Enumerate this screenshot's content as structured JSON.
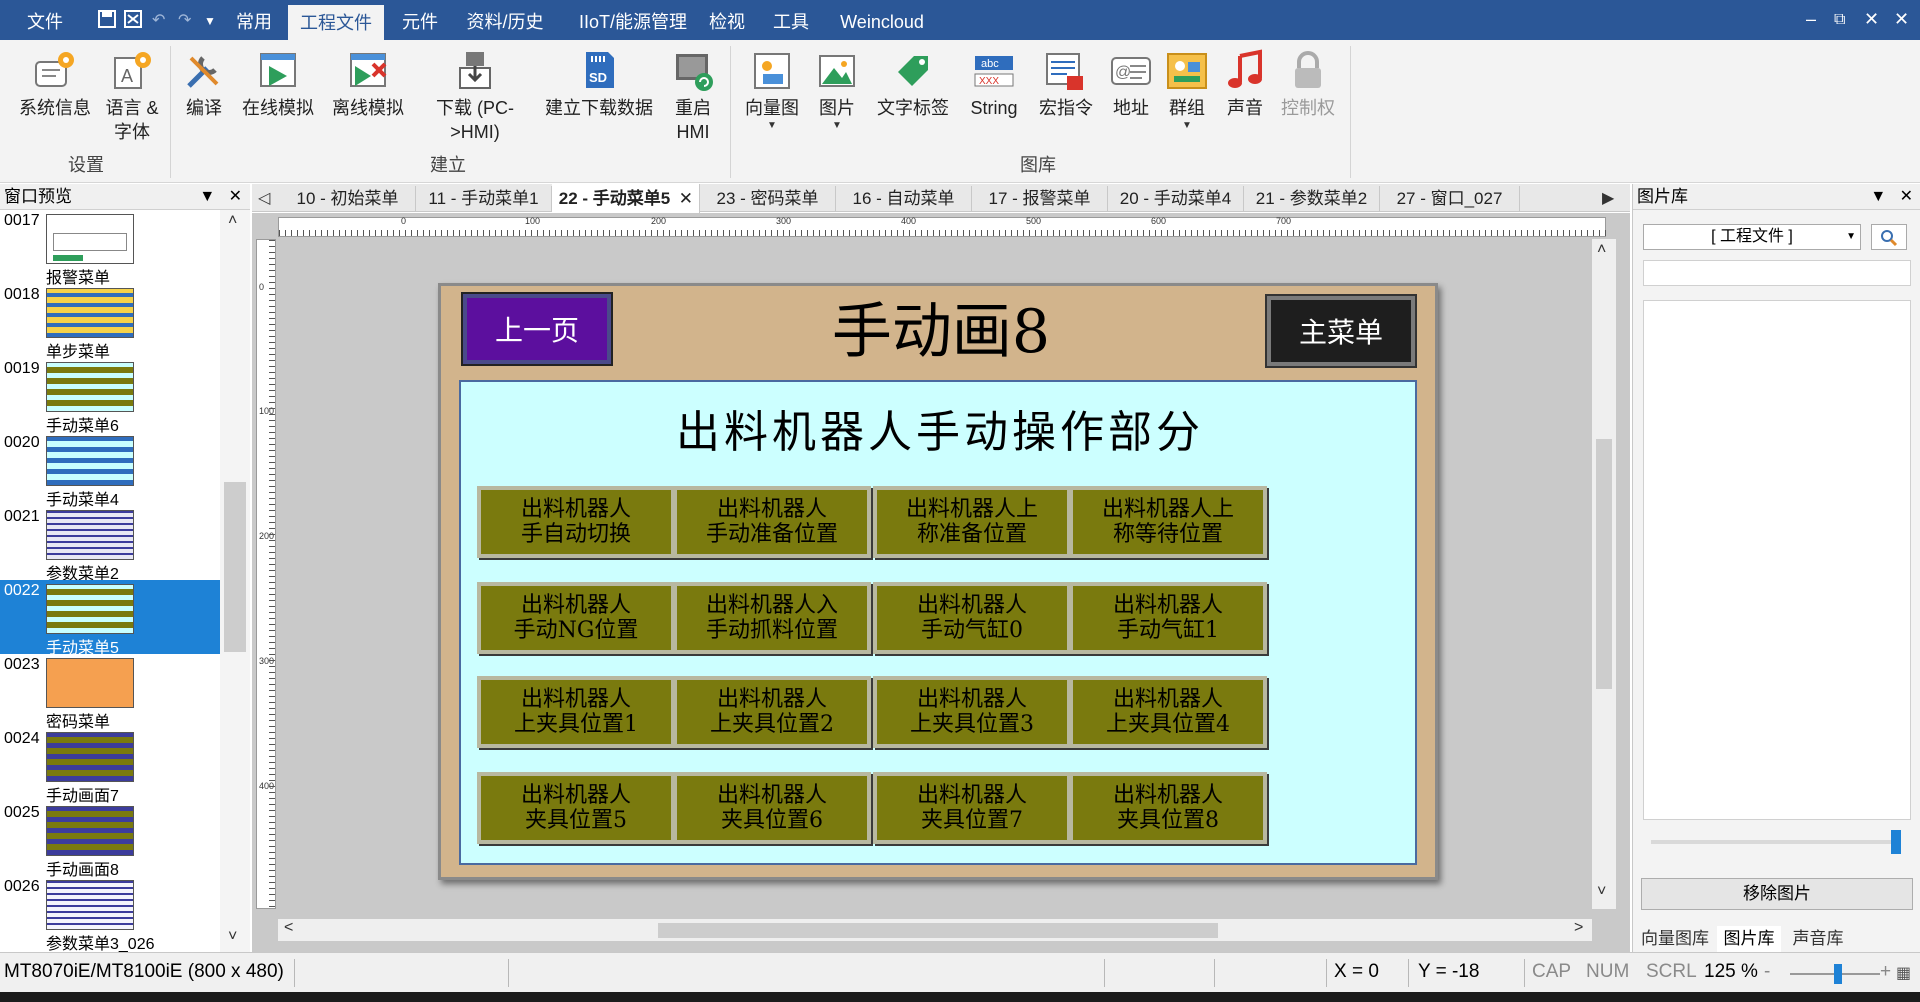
{
  "menubar": {
    "items": [
      "文件",
      "常用",
      "工程文件",
      "元件",
      "资料/历史",
      "IIoT/能源管理",
      "检视",
      "工具",
      "Weincloud"
    ],
    "active": "工程文件",
    "window_controls": [
      "–",
      "🗗",
      "✕",
      "✕"
    ]
  },
  "ribbon": {
    "buttons": [
      {
        "label": "系统信息",
        "icon": "system-info-icon"
      },
      {
        "label": "语言 & 字体",
        "icon": "language-font-icon"
      },
      {
        "label": "编译",
        "icon": "compile-icon"
      },
      {
        "label": "在线模拟",
        "icon": "online-simulation-icon"
      },
      {
        "label": "离线模拟",
        "icon": "offline-simulation-icon"
      },
      {
        "label": "下载 (PC->HMI)",
        "icon": "download-icon"
      },
      {
        "label": "建立下载数据",
        "icon": "sd-card-icon"
      },
      {
        "label": "重启 HMI",
        "icon": "restart-hmi-icon"
      },
      {
        "label": "向量图",
        "icon": "vector-image-icon"
      },
      {
        "label": "图片",
        "icon": "picture-icon"
      },
      {
        "label": "文字标签",
        "icon": "text-tag-icon"
      },
      {
        "label": "String",
        "icon": "string-icon"
      },
      {
        "label": "宏指令",
        "icon": "macro-icon"
      },
      {
        "label": "地址",
        "icon": "address-icon"
      },
      {
        "label": "群组",
        "icon": "group-icon"
      },
      {
        "label": "声音",
        "icon": "sound-icon"
      },
      {
        "label": "控制权",
        "icon": "lock-icon"
      }
    ],
    "groups": [
      "设置",
      "建立",
      "图库"
    ]
  },
  "left_panel": {
    "title": "窗口预览",
    "items": [
      {
        "num": "0017",
        "name": "报警菜单"
      },
      {
        "num": "0018",
        "name": "单步菜单"
      },
      {
        "num": "0019",
        "name": "手动菜单6"
      },
      {
        "num": "0020",
        "name": "手动菜单4"
      },
      {
        "num": "0021",
        "name": "参数菜单2"
      },
      {
        "num": "0022",
        "name": "手动菜单5",
        "selected": true
      },
      {
        "num": "0023",
        "name": "密码菜单"
      },
      {
        "num": "0024",
        "name": "手动画面7"
      },
      {
        "num": "0025",
        "name": "手动画面8"
      },
      {
        "num": "0026",
        "name": "参数菜单3_026"
      }
    ]
  },
  "tabs": {
    "items": [
      "10 - 初始菜单",
      "11 - 手动菜单1",
      "22 - 手动菜单5",
      "23 - 密码菜单",
      "16 - 自动菜单",
      "17 - 报警菜单",
      "20 - 手动菜单4",
      "21 - 参数菜单2",
      "27 - 窗口_027"
    ],
    "active_index": 2
  },
  "ruler": {
    "h_ticks": [
      "0",
      "100",
      "200",
      "300",
      "400",
      "500",
      "600",
      "700"
    ],
    "v_ticks": [
      "0",
      "100",
      "200",
      "300",
      "400"
    ]
  },
  "hmi": {
    "prev_button": "上一页",
    "title": "手动画8",
    "main_button": "主菜单",
    "subtitle": "出料机器人手动操作部分",
    "buttons": [
      "出料机器人\n手自动切换",
      "出料机器人\n手动准备位置",
      "出料机器人上\n称准备位置",
      "出料机器人上\n称等待位置",
      "出料机器人\n手动NG位置",
      "出料机器人入\n手动抓料位置",
      "出料机器人\n手动气缸0",
      "出料机器人\n手动气缸1",
      "出料机器人\n上夹具位置1",
      "出料机器人\n上夹具位置2",
      "出料机器人\n上夹具位置3",
      "出料机器人\n上夹具位置4",
      "出料机器人\n夹具位置5",
      "出料机器人\n夹具位置6",
      "出料机器人\n夹具位置7",
      "出料机器人\n夹具位置8"
    ],
    "colors": {
      "frame": "#d2b48c",
      "panel": "#ccffff",
      "button": "#7a7a0e",
      "prev": "#5c0f9e",
      "main": "#1e1e1e"
    }
  },
  "right_panel": {
    "title": "图片库",
    "select_value": "[ 工程文件 ]",
    "remove_button": "移除图片",
    "tabs": [
      "向量图库",
      "图片库",
      "声音库"
    ],
    "active_tab": "图片库"
  },
  "status": {
    "model": "MT8070iE/MT8100iE (800 x 480)",
    "x": "X = 0",
    "y": "Y = -18",
    "cap": "CAP",
    "num": "NUM",
    "scrl": "SCRL",
    "zoom": "125 %"
  },
  "colors": {
    "accent": "#2b5797",
    "selection": "#1e82d6"
  }
}
